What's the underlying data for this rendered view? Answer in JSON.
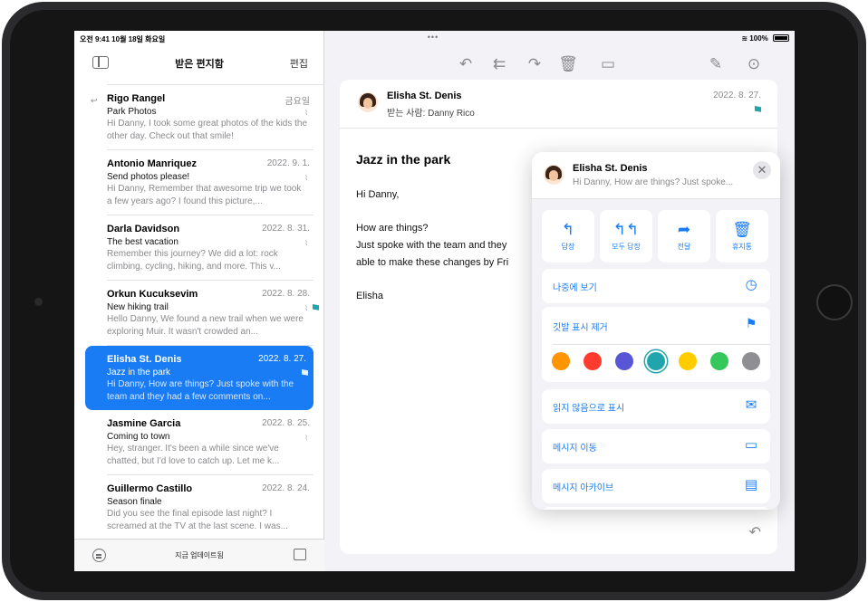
{
  "status": {
    "time_date": "오전 9:41  10월 18일 화요일",
    "dots": "•••",
    "battery": "100%"
  },
  "list": {
    "title": "받은 편지함",
    "edit": "편집",
    "footer_status": "지금 업데이트됨",
    "messages": [
      {
        "sender": "Rigo Rangel",
        "date": "금요일",
        "subject": "Park Photos",
        "preview": "Hi Danny, I took some great photos of the kids the other day. Check out that smile!",
        "replied": true
      },
      {
        "sender": "Antonio Manriquez",
        "date": "2022. 9. 1.",
        "subject": "Send photos please!",
        "preview": "Hi Danny, Remember that awesome trip we took a few years ago? I found this picture,..."
      },
      {
        "sender": "Darla Davidson",
        "date": "2022. 8. 31.",
        "subject": "The best vacation",
        "preview": "Remember this journey? We did a lot: rock climbing, cycling, hiking, and more. This v..."
      },
      {
        "sender": "Orkun Kucuksevim",
        "date": "2022. 8. 28.",
        "subject": "New hiking trail",
        "preview": "Hello Danny, We found a new trail when we were exploring Muir. It wasn't crowded an...",
        "flagged": true
      },
      {
        "sender": "Elisha St. Denis",
        "date": "2022. 8. 27.",
        "subject": "Jazz in the park",
        "preview": "Hi Danny, How are things? Just spoke with the team and they had a few comments on...",
        "flagged": true,
        "selected": true
      },
      {
        "sender": "Jasmine Garcia",
        "date": "2022. 8. 25.",
        "subject": "Coming to town",
        "preview": "Hey, stranger. It's been a while since we've chatted, but I'd love to catch up. Let me k..."
      },
      {
        "sender": "Guillermo Castillo",
        "date": "2022. 8. 24.",
        "subject": "Season finale",
        "preview": "Did you see the final episode last night? I screamed at the TV at the last scene. I was..."
      }
    ]
  },
  "mail": {
    "sender": "Elisha St. Denis",
    "to": "받는 사람: Danny Rico",
    "date": "2022. 8. 27.",
    "subject": "Jazz in the park",
    "greeting": "Hi Danny,",
    "body_line1": "How are things?",
    "body_line2": "Just spoke with the team and they",
    "body_line3": "able to make these changes by Fri",
    "signature": "Elisha"
  },
  "popover": {
    "sender": "Elisha St. Denis",
    "preview": "Hi Danny, How are things? Just spoke...",
    "close": "✕",
    "actions": [
      {
        "label": "답장",
        "icon": "reply-icon",
        "glyph": "↰"
      },
      {
        "label": "모두 답장",
        "icon": "reply-all-icon",
        "glyph": "↰↰"
      },
      {
        "label": "전달",
        "icon": "forward-icon",
        "glyph": "➦"
      },
      {
        "label": "휴지통",
        "icon": "trash-icon",
        "glyph": "🗑"
      }
    ],
    "remind_later": "나중에 보기",
    "remove_flag": "깃발 표시 제거",
    "flag_colors": [
      "#ff9500",
      "#ff3b30",
      "#5856d6",
      "#1fa5ab",
      "#ffcc00",
      "#34c759",
      "#8e8e93"
    ],
    "selected_flag_color": "#1fa5ab",
    "mark_unread": "읽지 않음으로 표시",
    "move_message": "메시지 이동",
    "archive_message": "메시지 아카이브"
  },
  "colors": {
    "accent": "#1a7cf5",
    "flag": "#1fa5ab"
  }
}
